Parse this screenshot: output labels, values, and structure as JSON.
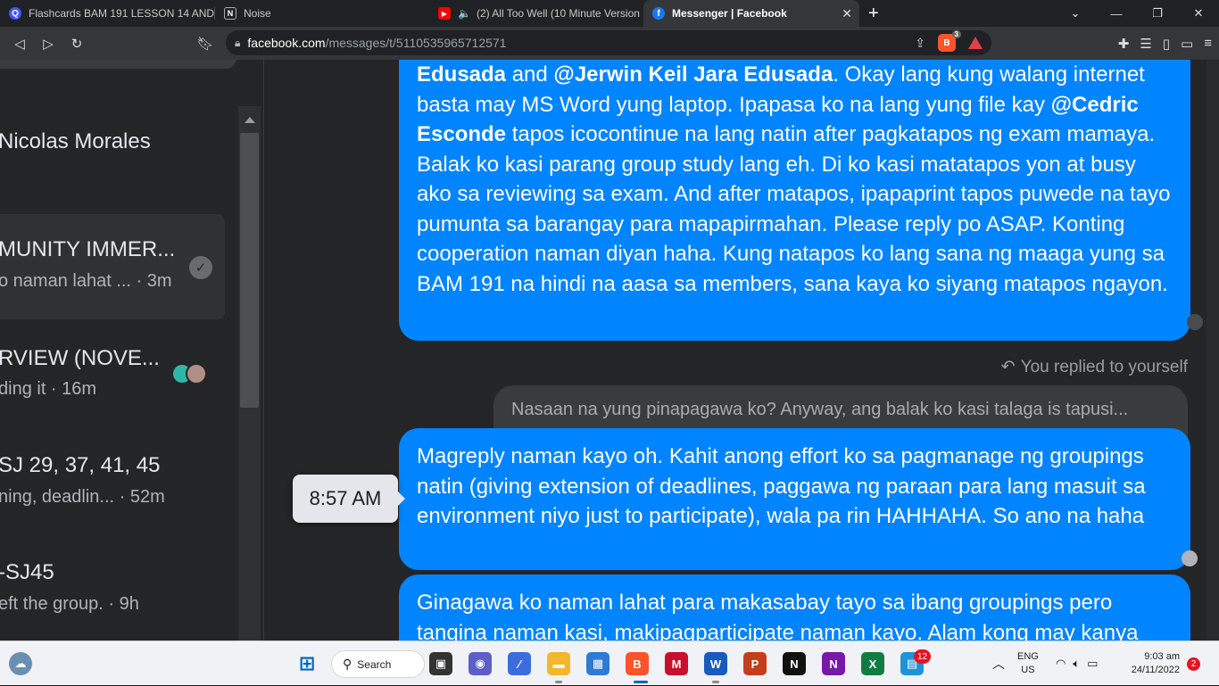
{
  "tabs": [
    {
      "title": "Flashcards BAM 191 LESSON 14 AND",
      "icon": "quizlet-icon",
      "color": "#4255ff"
    },
    {
      "title": "Noise",
      "icon": "notion-icon",
      "color": "#202124"
    },
    {
      "title": "(2) All Too Well (10 Minute Version",
      "icon": "youtube-icon",
      "color": "#ff0000"
    },
    {
      "title": "Messenger | Facebook",
      "icon": "facebook-icon",
      "color": "#1877f2"
    }
  ],
  "address": {
    "host": "facebook.com",
    "path": "/messages/t/5110535965712571",
    "brave_count": "3"
  },
  "conversations": [
    {
      "title": "Nicolas Morales",
      "subtitle": ""
    },
    {
      "title": "MUNITY IMMER...",
      "subtitle": "o naman lahat ... · 3m"
    },
    {
      "title": "RVIEW (NOVE...",
      "subtitle": "ding it · 16m"
    },
    {
      "title": "SJ 29, 37, 41, 45",
      "subtitle": "ning, deadlin... · 52m"
    },
    {
      "title": "-SJ45",
      "subtitle": "eft the group. · 9h"
    }
  ],
  "messages": {
    "m1": {
      "p1": "Edusada",
      "p2": " and ",
      "p3": "@Jerwin Keil Jara Edusada",
      "p4": ". Okay lang kung walang internet basta may MS Word yung laptop. Ipapasa ko na lang yung file kay ",
      "p5": "@Cedric Esconde",
      "p6": " tapos icocontinue na lang natin after pagkatapos ng exam mamaya. Balak ko kasi parang group study lang eh. Di ko kasi matatapos yon at busy ako sa reviewing sa exam. And after matapos, ipapaprint tapos puwede na tayo pumunta sa barangay para mapapirmahan. Please reply po ASAP. Konting cooperation naman diyan haha. Kung natapos ko lang sana ng maaga yung sa BAM 191 na hindi na aasa sa members, sana kaya ko siyang matapos ngayon."
    },
    "replied_label": "You replied to yourself",
    "quoted": "Nasaan na yung pinapagawa ko? Anyway, ang balak ko kasi talaga is tapusi...",
    "m2": "Magreply naman kayo oh. Kahit anong effort ko sa pagmanage ng groupings natin (giving extension of deadlines, paggawa ng paraan para lang masuit sa environment niyo just to participate), wala pa rin HAHHAHA. So ano na haha",
    "m3": "Ginagawa ko naman lahat para makasabay tayo sa ibang groupings pero tangina naman kasi, makipagparticipate naman kayo. Alam kong may kanya",
    "timestamp": "8:57 AM"
  },
  "taskbar": {
    "search_label": "Search",
    "teams_badge": "12",
    "lang": "ENG",
    "region": "US",
    "time": "9:03 am",
    "date": "24/11/2022",
    "notif_count": "2"
  },
  "colors": {
    "accent": "#0084ff",
    "bg": "#242526"
  }
}
